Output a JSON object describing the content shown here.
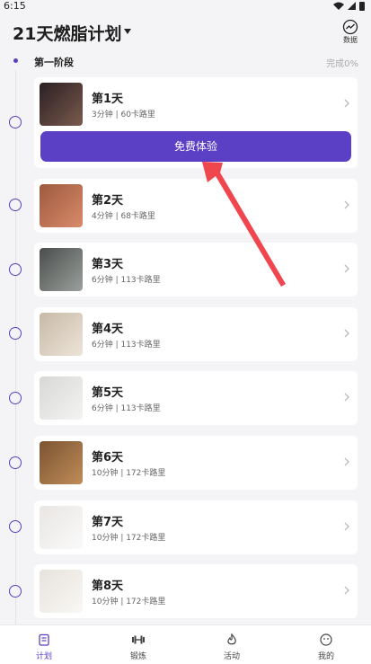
{
  "status_bar": {
    "time": "6:15"
  },
  "header": {
    "title": "21天燃脂计划",
    "data_button_label": "数据"
  },
  "stage": {
    "name": "第一阶段",
    "progress": "完成0%"
  },
  "trial_button_label": "免费体验",
  "days": [
    {
      "title": "第1天",
      "meta": "3分钟 | 60卡路里",
      "thumb_colors": [
        "#2b1f22",
        "#7a5b4e"
      ]
    },
    {
      "title": "第2天",
      "meta": "4分钟 | 68卡路里",
      "thumb_colors": [
        "#9c5a3e",
        "#d98a6a"
      ]
    },
    {
      "title": "第3天",
      "meta": "6分钟 | 113卡路里",
      "thumb_colors": [
        "#4a4d4b",
        "#9aa09d"
      ]
    },
    {
      "title": "第4天",
      "meta": "6分钟 | 113卡路里",
      "thumb_colors": [
        "#c7b9a8",
        "#ede4d8"
      ]
    },
    {
      "title": "第5天",
      "meta": "6分钟 | 113卡路里",
      "thumb_colors": [
        "#d8d8d6",
        "#f3f3f1"
      ]
    },
    {
      "title": "第6天",
      "meta": "10分钟 | 172卡路里",
      "thumb_colors": [
        "#7a5432",
        "#c08c58"
      ]
    },
    {
      "title": "第7天",
      "meta": "10分钟 | 172卡路里",
      "thumb_colors": [
        "#e9e6e3",
        "#fafafa"
      ]
    },
    {
      "title": "第8天",
      "meta": "10分钟 | 172卡路里",
      "thumb_colors": [
        "#e7e2dc",
        "#f9f8f5"
      ]
    }
  ],
  "tabs": [
    {
      "label": "计划",
      "icon": "plan-icon",
      "active": true
    },
    {
      "label": "锻炼",
      "icon": "dumbbell-icon",
      "active": false
    },
    {
      "label": "活动",
      "icon": "flame-icon",
      "active": false
    },
    {
      "label": "我的",
      "icon": "profile-icon",
      "active": false
    }
  ],
  "colors": {
    "accent": "#5b3fc4",
    "arrow": "#f0474f",
    "background": "#f4f4f6"
  }
}
